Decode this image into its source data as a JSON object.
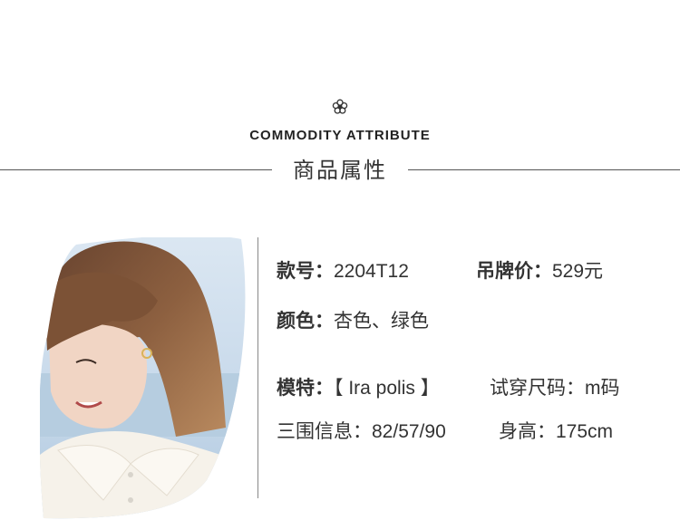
{
  "header": {
    "icon": "flower-icon",
    "title_en": "COMMODITY ATTRIBUTE",
    "title_cn": "商品属性"
  },
  "photo": {
    "subject": "model-photo"
  },
  "attributes": {
    "style_no": {
      "label": "款号：",
      "value": "2204T12"
    },
    "tag_price": {
      "label": "吊牌价：",
      "value": "529元"
    },
    "color": {
      "label": "颜色：",
      "value": "杏色、绿色"
    },
    "model": {
      "label": "模特：",
      "value": "【 Ira polis 】"
    },
    "trial_size": {
      "label": "试穿尺码：",
      "value": "m码"
    },
    "measurements": {
      "label": "三围信息：",
      "value": "82/57/90"
    },
    "height": {
      "label": "身高：",
      "value": "175cm"
    }
  }
}
